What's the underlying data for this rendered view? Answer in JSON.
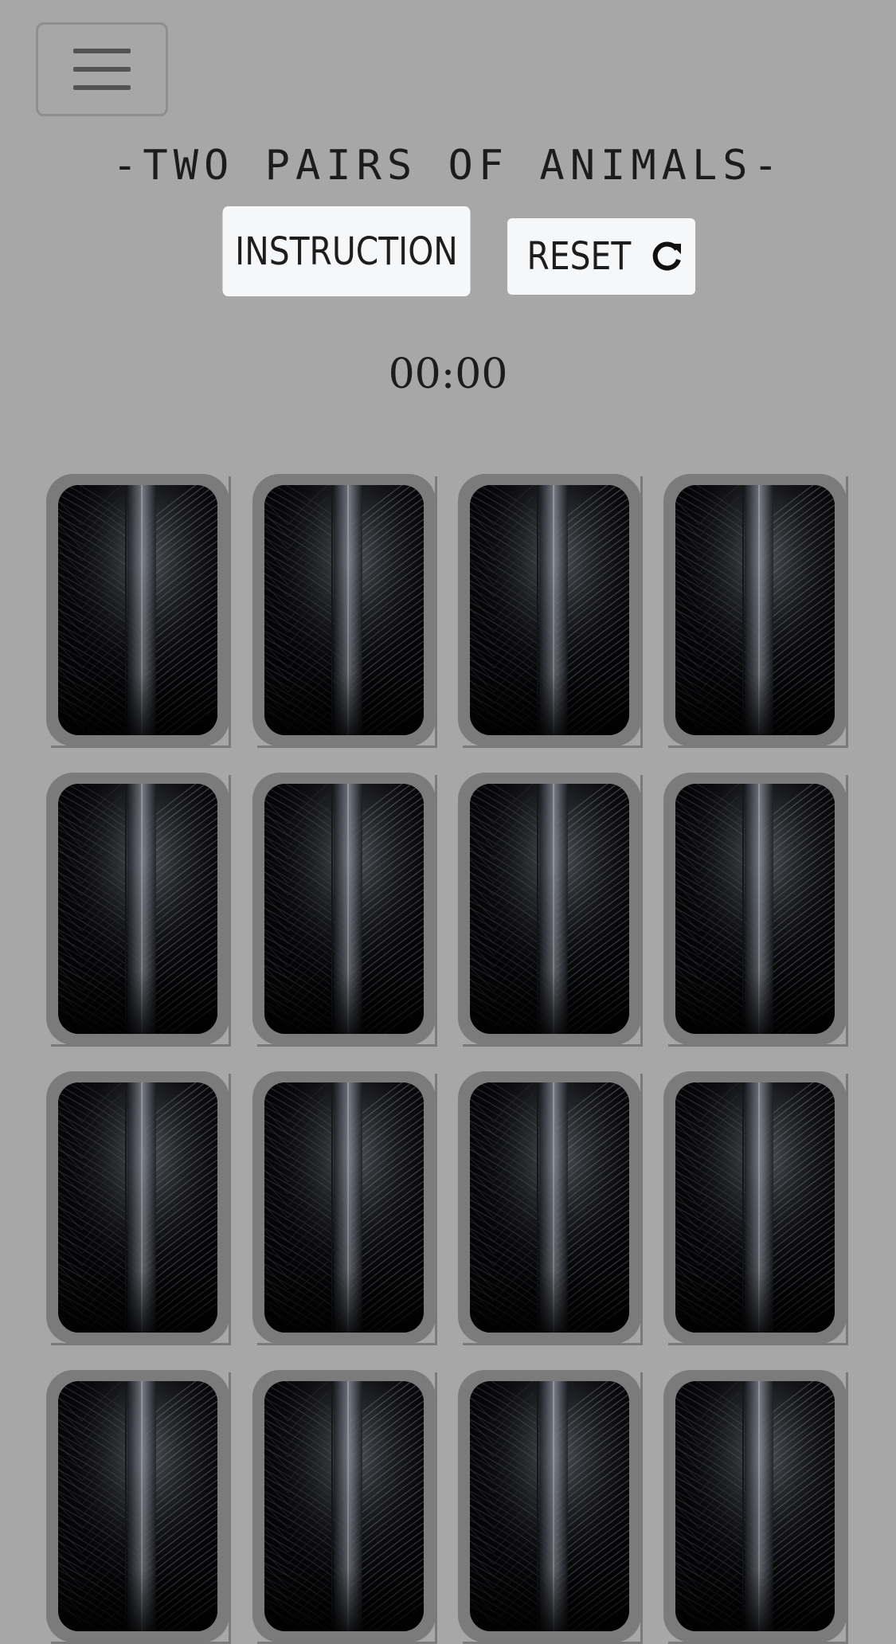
{
  "header": {
    "menu_icon": "hamburger-menu-icon",
    "title": "-TWO PAIRS OF ANIMALS-"
  },
  "controls": {
    "instruction_label": "INSTRUCTION",
    "reset_label": "RESET",
    "reset_icon": "refresh-icon"
  },
  "timer": {
    "value": "00:00"
  },
  "board": {
    "columns": 4,
    "card_back": "feather-pattern",
    "cards": [
      {
        "state": "face-down"
      },
      {
        "state": "face-down"
      },
      {
        "state": "face-down"
      },
      {
        "state": "face-down"
      },
      {
        "state": "face-down"
      },
      {
        "state": "face-down"
      },
      {
        "state": "face-down"
      },
      {
        "state": "face-down"
      },
      {
        "state": "face-down"
      },
      {
        "state": "face-down"
      },
      {
        "state": "face-down"
      },
      {
        "state": "face-down"
      },
      {
        "state": "face-down"
      },
      {
        "state": "face-down"
      },
      {
        "state": "face-down"
      },
      {
        "state": "face-down"
      }
    ]
  },
  "colors": {
    "background": "#a7a7a7",
    "button_bg": "#f6f7f9",
    "card_frame": "#7b7b7b",
    "card_back": "#050505"
  }
}
